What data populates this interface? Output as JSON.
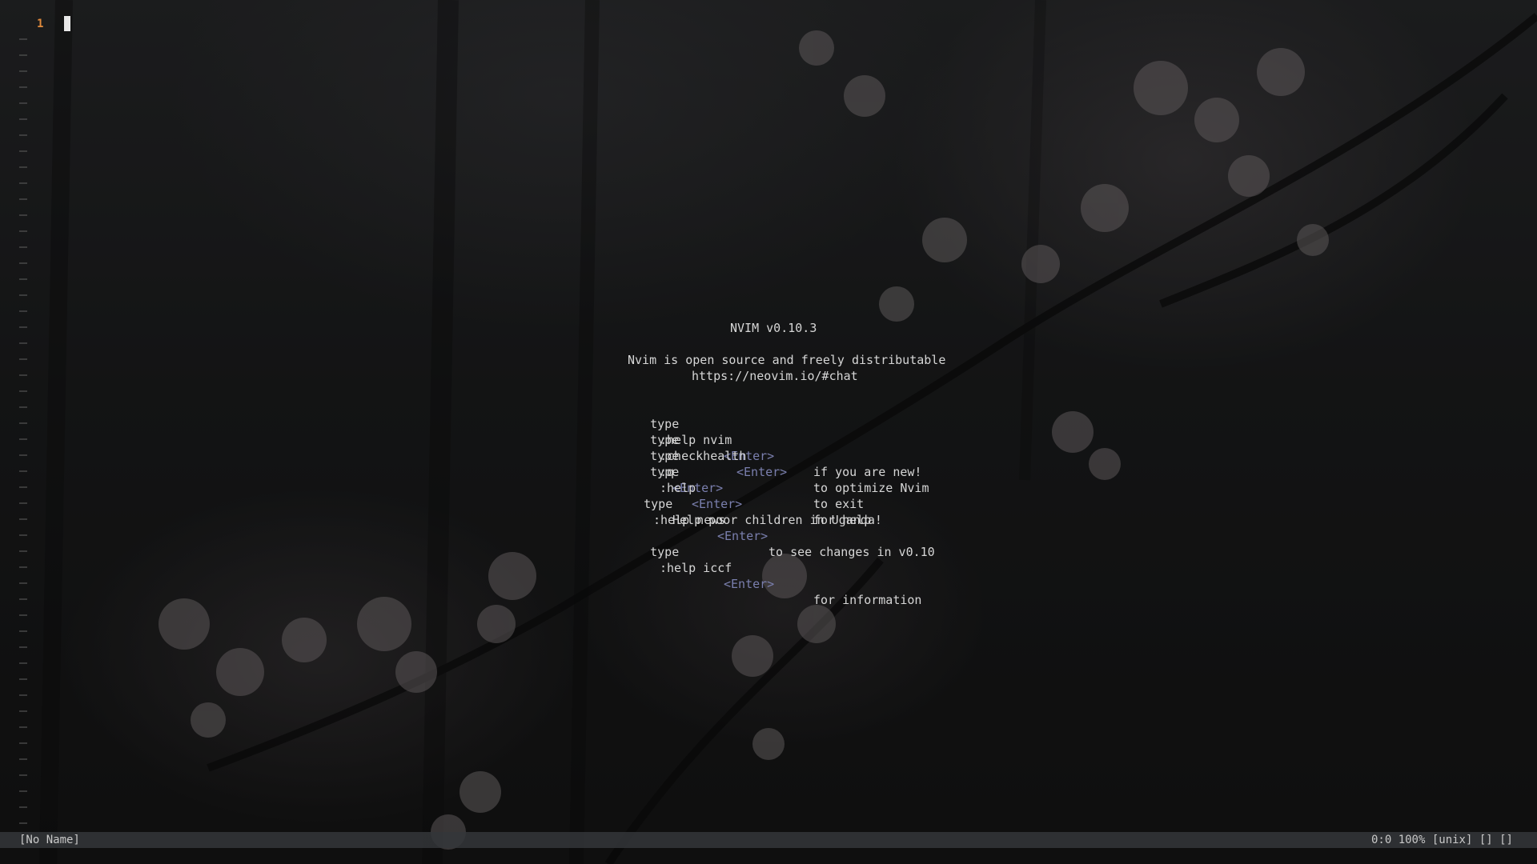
{
  "editor": {
    "line_number": "1",
    "empty_line_marker": "~"
  },
  "intro": {
    "version": "NVIM v0.10.3",
    "tagline": "Nvim is open source and freely distributable",
    "url": "https://neovim.io/#chat",
    "commands": [
      {
        "prefix": "type",
        "cmd": ":help nvim",
        "enter": "<Enter>",
        "desc": "if you are new!"
      },
      {
        "prefix": "type",
        "cmd": ":checkhealth",
        "enter": "<Enter>",
        "desc": "to optimize Nvim"
      },
      {
        "prefix": "type",
        "cmd": ":q",
        "enter": "<Enter>",
        "desc": "to exit"
      },
      {
        "prefix": "type",
        "cmd": ":help",
        "enter": "<Enter>",
        "desc": "for help"
      }
    ],
    "news": {
      "prefix": "type",
      "cmd": ":help news",
      "enter": "<Enter>",
      "desc": "to see changes in v0.10"
    },
    "charity": "Help poor children in Uganda!",
    "iccf": {
      "prefix": "type",
      "cmd": ":help iccf",
      "enter": "<Enter>",
      "desc": "for information"
    }
  },
  "statusline": {
    "filename": "[No Name]",
    "right": "0:0 100% [unix] [] []"
  },
  "colors": {
    "line_number": "#e08a3c",
    "special_key": "#7a7fae",
    "text": "#d6d6d6"
  }
}
